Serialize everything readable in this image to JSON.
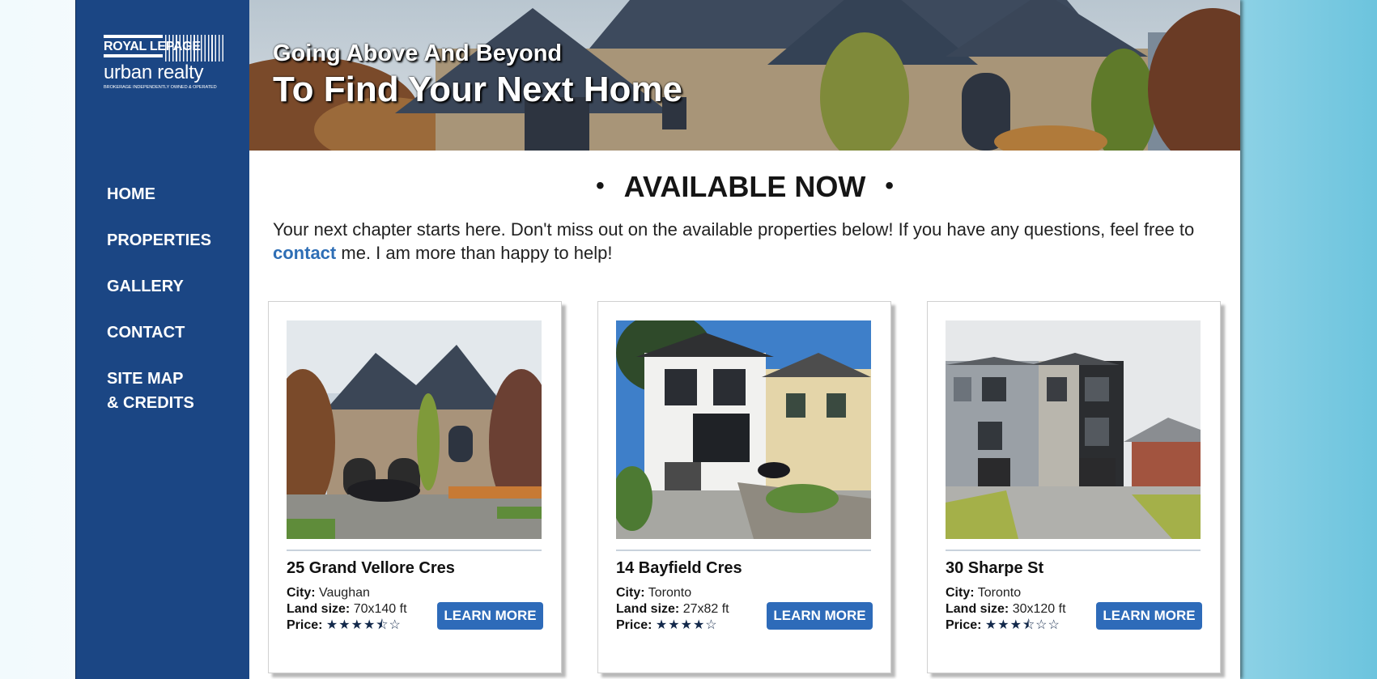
{
  "logo": {
    "brand_line": "ROYAL LEPAGE",
    "sub_line": "urban realty",
    "tagline": "BROKERAGE INDEPENDENTLY OWNED & OPERATED"
  },
  "nav": {
    "items": [
      {
        "label": "HOME"
      },
      {
        "label": "PROPERTIES"
      },
      {
        "label": "GALLERY"
      },
      {
        "label": "CONTACT"
      },
      {
        "label_line1": "SITE MAP",
        "label_line2": "& CREDITS"
      }
    ]
  },
  "hero": {
    "line1": "Going Above And Beyond",
    "line2": "To Find Your Next Home"
  },
  "section": {
    "bullet": "•",
    "title": "AVAILABLE NOW",
    "intro_before": "Your next chapter starts here. Don't miss out on the available properties below! If you have any questions, feel free to ",
    "intro_link": "contact",
    "intro_after": " me. I am more than happy to help!"
  },
  "labels": {
    "city": "City:",
    "land_size": "Land size:",
    "price": "Price:",
    "learn_more": "LEARN MORE"
  },
  "properties": [
    {
      "title": "25 Grand Vellore Cres",
      "city": "Vaughan",
      "land_size": "70x140 ft",
      "price_stars": "★★★★⯪☆",
      "price_rating": 4.5
    },
    {
      "title": "14 Bayfield Cres",
      "city": "Toronto",
      "land_size": "27x82 ft",
      "price_stars": "★★★★☆",
      "price_rating": 4
    },
    {
      "title": "30 Sharpe St",
      "city": "Toronto",
      "land_size": "30x120 ft",
      "price_stars": "★★★⯪☆☆",
      "price_rating": 3.5
    }
  ],
  "colors": {
    "sidebar": "#1b4684",
    "button": "#2e6bb9",
    "link": "#2e6eb5",
    "stars": "#13294b"
  }
}
